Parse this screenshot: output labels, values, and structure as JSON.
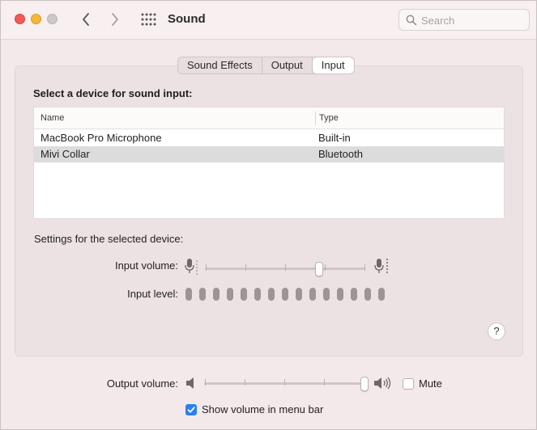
{
  "window": {
    "title": "Sound",
    "search_placeholder": "Search"
  },
  "tabs": [
    {
      "label": "Sound Effects",
      "active": false
    },
    {
      "label": "Output",
      "active": false
    },
    {
      "label": "Input",
      "active": true
    }
  ],
  "input": {
    "section_label": "Select a device for sound input:",
    "columns": {
      "name": "Name",
      "type": "Type"
    },
    "devices": [
      {
        "name": "MacBook Pro Microphone",
        "type": "Built-in",
        "selected": false
      },
      {
        "name": "Mivi Collar",
        "type": "Bluetooth",
        "selected": true
      }
    ],
    "settings_label": "Settings for the selected device:",
    "input_volume_label": "Input volume:",
    "input_volume_fraction": 0.71,
    "input_level_label": "Input level:",
    "input_level_segments": 15,
    "input_level_lit": 0
  },
  "help_label": "?",
  "output": {
    "volume_label": "Output volume:",
    "volume_fraction": 1.0,
    "mute_label": "Mute",
    "mute_checked": false,
    "show_in_menu_bar_label": "Show volume in menu bar",
    "show_in_menu_bar_checked": true
  },
  "colors": {
    "accent": "#2a7ff0",
    "close": "#f25a55",
    "minimize": "#f5b73a"
  }
}
